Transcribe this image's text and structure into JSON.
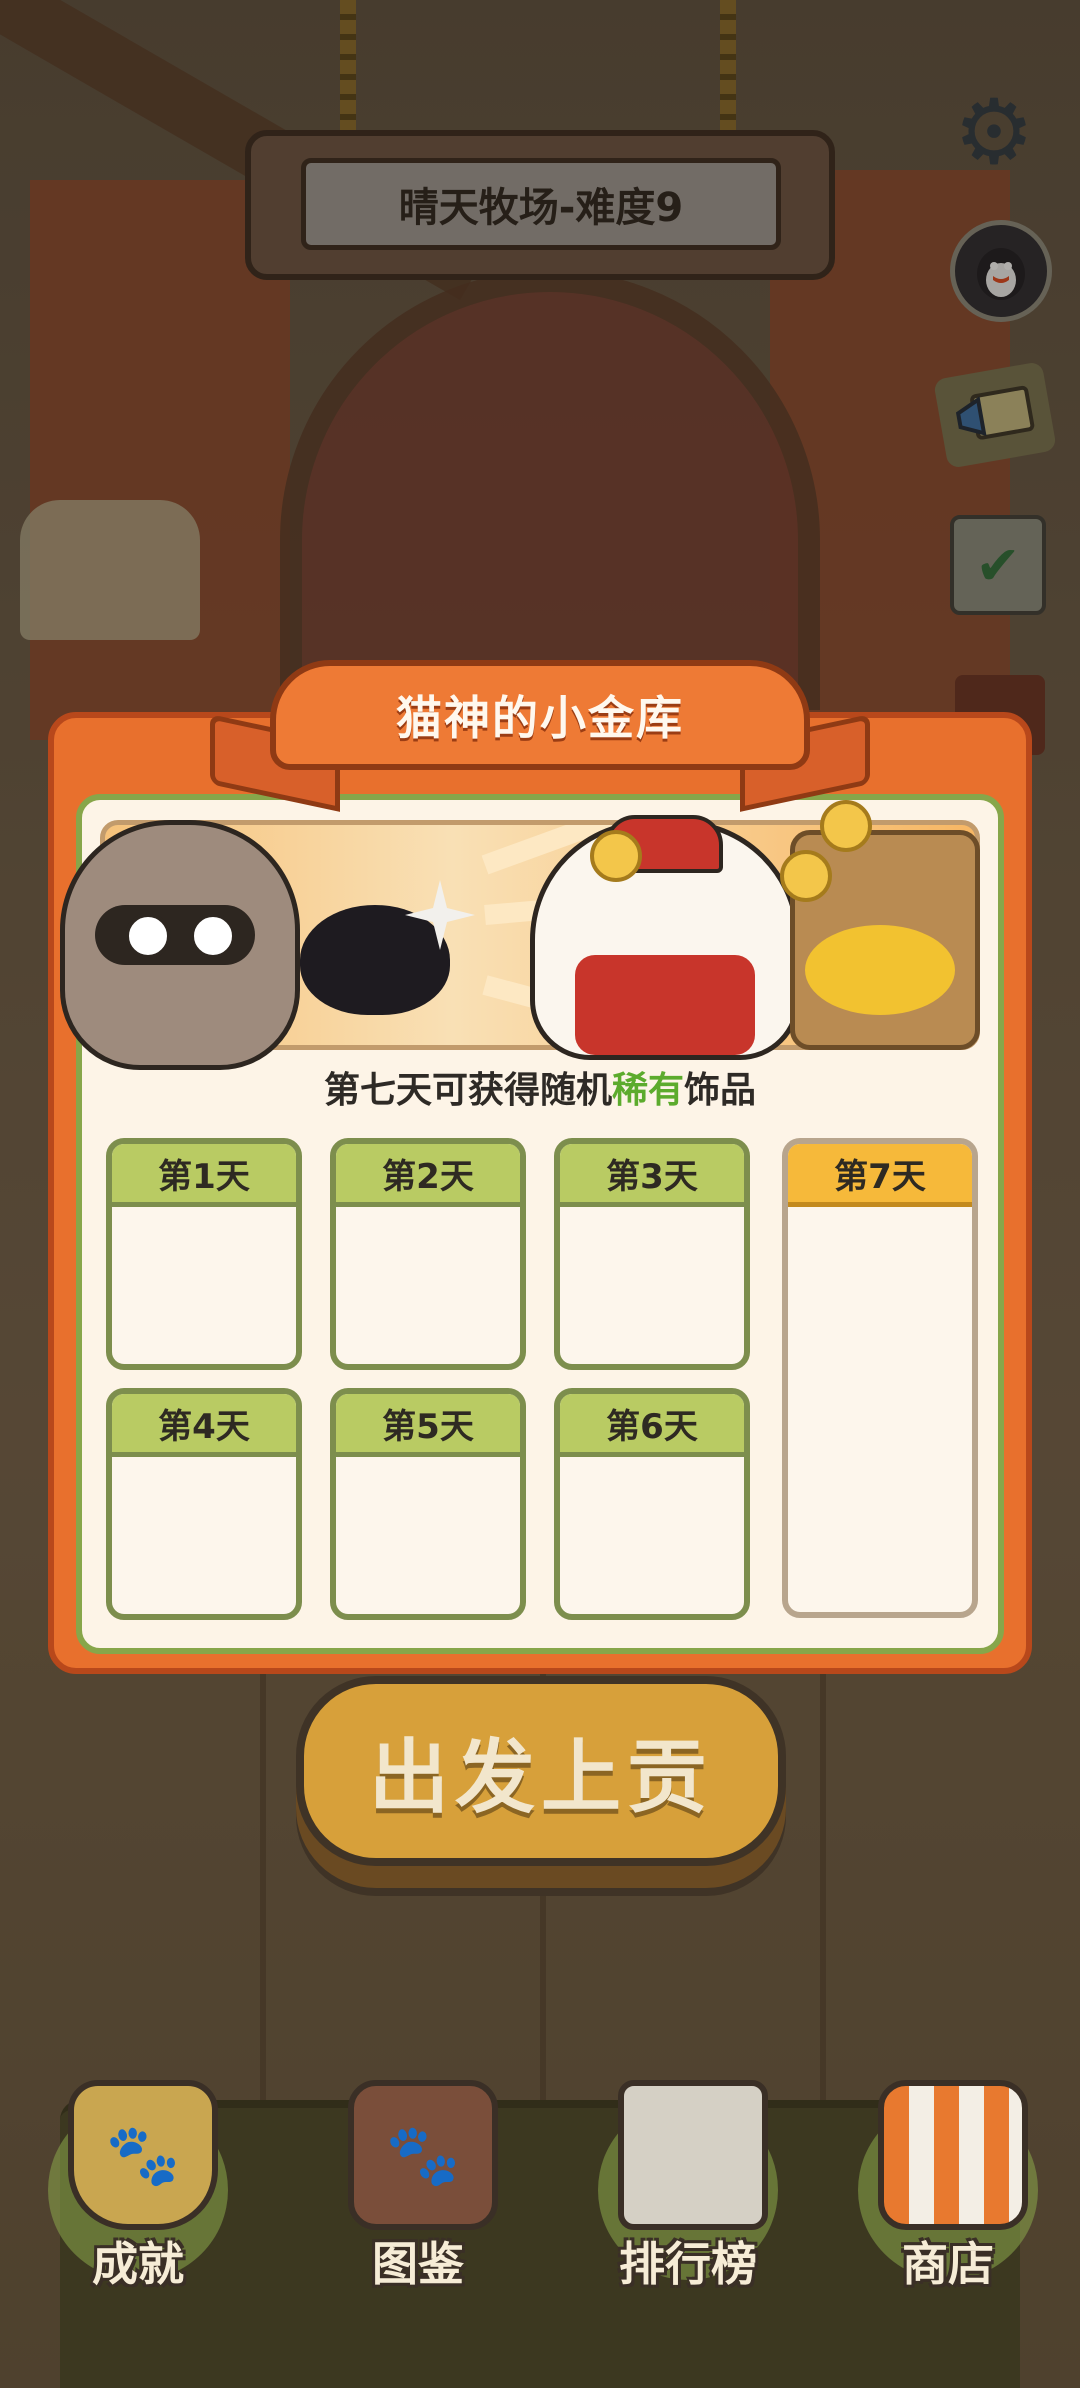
{
  "header": {
    "stage_title": "晴天牧场-难度9"
  },
  "side_icons": [
    "gear-icon",
    "penguin-icon",
    "megaphone-mail-icon",
    "calendar-check-icon"
  ],
  "modal": {
    "title": "猫神的小金库",
    "subtitle_prefix": "第七天可获得随机",
    "subtitle_highlight": "稀有",
    "subtitle_suffix": "饰品",
    "days": [
      "第1天",
      "第2天",
      "第3天",
      "第4天",
      "第5天",
      "第6天",
      "第7天"
    ]
  },
  "action_button": {
    "label": "出发上贡"
  },
  "bottom_nav": {
    "achievements": "成就",
    "collection": "图鉴",
    "leaderboard": "排行榜",
    "shop": "商店"
  },
  "colors": {
    "modal_orange": "#e8702d",
    "card_green": "#b9cb63",
    "card_gold": "#f6b93a",
    "rare_text": "#5cab2d"
  }
}
